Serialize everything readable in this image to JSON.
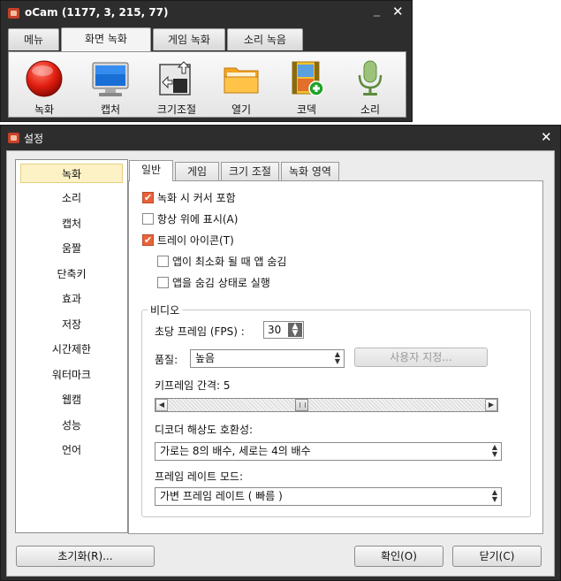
{
  "ocam": {
    "title": "oCam (1177, 3, 215, 77)",
    "minimize_glyph": "_",
    "close_glyph": "✕",
    "tabs": [
      {
        "label": "메뉴"
      },
      {
        "label": "화면 녹화"
      },
      {
        "label": "게임 녹화"
      },
      {
        "label": "소리 녹음"
      }
    ],
    "active_tab": "화면 녹화",
    "tools": [
      {
        "label": "녹화",
        "icon": "record-icon"
      },
      {
        "label": "캡처",
        "icon": "monitor-icon"
      },
      {
        "label": "크기조절",
        "icon": "resize-icon"
      },
      {
        "label": "열기",
        "icon": "folder-icon"
      },
      {
        "label": "코덱",
        "icon": "codec-film-icon"
      },
      {
        "label": "소리",
        "icon": "microphone-icon"
      }
    ]
  },
  "settings": {
    "title": "설정",
    "close_glyph": "✕",
    "nav": [
      {
        "label": "녹화"
      },
      {
        "label": "소리"
      },
      {
        "label": "캡처"
      },
      {
        "label": "움짤"
      },
      {
        "label": "단축키"
      },
      {
        "label": "효과"
      },
      {
        "label": "저장"
      },
      {
        "label": "시간제한"
      },
      {
        "label": "워터마크"
      },
      {
        "label": "웹캠"
      },
      {
        "label": "성능"
      },
      {
        "label": "언어"
      }
    ],
    "selected_nav": "녹화",
    "tabs": [
      {
        "label": "일반"
      },
      {
        "label": "게임"
      },
      {
        "label": "크기 조절"
      },
      {
        "label": "녹화 영역"
      }
    ],
    "active_tab": "일반",
    "checkboxes": [
      {
        "label": "녹화 시 커서 포함",
        "checked": true
      },
      {
        "label": "항상 위에 표시(A)",
        "checked": false
      },
      {
        "label": "트레이 아이콘(T)",
        "checked": true
      },
      {
        "label": "앱이 최소화 될 때 앱 숨김",
        "checked": false
      },
      {
        "label": "앱을 숨김 상태로 실행",
        "checked": false
      }
    ],
    "video": {
      "legend": "비디오",
      "fps_label": "초당 프레임 (FPS) :",
      "fps_value": "30",
      "quality_label": "품질:",
      "quality_value": "높음",
      "custom_button": "사용자 지정...",
      "keyframe_label": "키프레임 간격: 5",
      "keyframe_fraction": 0.42,
      "decoder_label": "디코더 해상도 호환성:",
      "decoder_value": "가로는 8의 배수, 세로는 4의 배수",
      "framerate_mode_label": "프레임 레이트 모드:",
      "framerate_mode_value": "가변 프레임 레이트 ( 빠름 )"
    },
    "buttons": {
      "reset": "초기화(R)...",
      "ok": "확인(O)",
      "close": "닫기(C)"
    }
  },
  "colors": {
    "titlebar": "#2d2d2d",
    "checkbox_on": "#e8633a",
    "nav_selected": "#fdf1c6"
  }
}
